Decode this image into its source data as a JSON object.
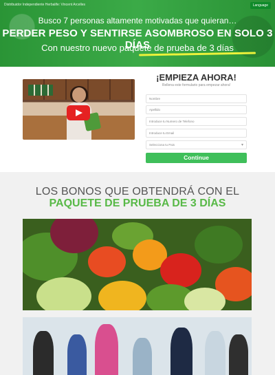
{
  "hero": {
    "top_line": "Distribuidor Independiente Herbalife: Vincent Arcelles",
    "language_button": "Language",
    "line1": "Busco 7 personas altamente motivadas que quieran…",
    "line2": "PERDER PESO Y SENTIRSE ASOMBROSO EN SOLO 3 DÍAS",
    "line3": "Con nuestro nuevo paquete de prueba de 3 días",
    "accent_color": "#2fa53c",
    "underline_color": "#ecf23a"
  },
  "video": {
    "play_icon": "youtube-play-icon"
  },
  "form": {
    "title": "¡EMPIEZA AHORA!",
    "subtitle": "Rellena este formulario para empezar ahora!",
    "fields": [
      {
        "placeholder": "Nombre"
      },
      {
        "placeholder": "Apellido"
      },
      {
        "placeholder": "Introduce tu Numero de Telefono"
      },
      {
        "placeholder": "Introduce tu Email"
      }
    ],
    "select_placeholder": "Selecciona tu Pais",
    "submit_label": "Continue",
    "button_color": "#3fbf5a"
  },
  "bonus": {
    "title_line1": "LOS BONOS QUE OBTENDRÁ CON EL",
    "title_line2": "PAQUETE DE PRUEBA DE 3 DÍAS",
    "highlight_color": "#58b947"
  }
}
